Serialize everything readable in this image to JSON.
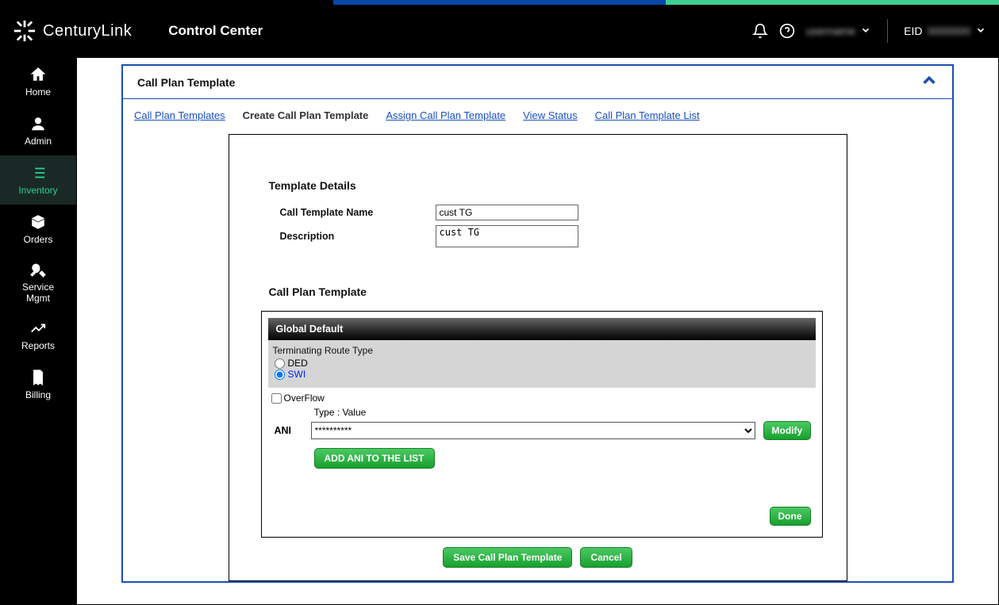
{
  "brand": "CenturyLink",
  "app_title": "Control Center",
  "header": {
    "user_name": "username",
    "eid_label": "EID",
    "eid_value": "0000000"
  },
  "sidebar": {
    "items": [
      {
        "label": "Home"
      },
      {
        "label": "Admin"
      },
      {
        "label": "Inventory"
      },
      {
        "label": "Orders"
      },
      {
        "label": "Service Mgmt"
      },
      {
        "label": "Reports"
      },
      {
        "label": "Billing"
      }
    ]
  },
  "panel": {
    "title": "Call Plan Template"
  },
  "tabs": {
    "call_plan_templates": "Call Plan Templates",
    "create": "Create Call Plan Template",
    "assign": "Assign Call Plan Template",
    "view_status": "View Status",
    "list": "Call Plan Template List"
  },
  "template_details": {
    "section_title": "Template Details",
    "name_label": "Call Template Name",
    "name_value": "cust TG",
    "desc_label": "Description",
    "desc_value": "cust TG"
  },
  "call_plan": {
    "section_title": "Call Plan Template",
    "header": "Global Default",
    "route_type_label": "Terminating Route Type",
    "ded_label": "DED",
    "swi_label": "SWI",
    "overflow_label": "OverFlow",
    "typevalue_label": "Type : Value",
    "ani_label": "ANI",
    "ani_selected": "**********",
    "modify_btn": "Modify",
    "add_ani_btn": "ADD ANI TO THE LIST",
    "done_btn": "Done"
  },
  "actions": {
    "save": "Save Call Plan Template",
    "cancel": "Cancel"
  }
}
